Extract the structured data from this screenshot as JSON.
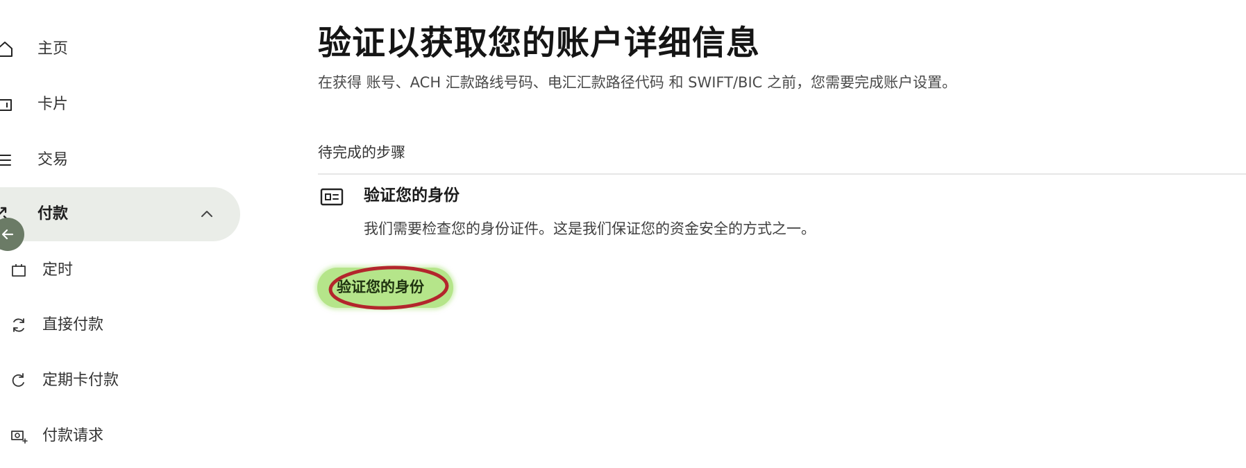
{
  "sidebar": {
    "items": [
      {
        "label": "主页",
        "icon": "home-icon"
      },
      {
        "label": "卡片",
        "icon": "card-icon"
      },
      {
        "label": "交易",
        "icon": "list-icon"
      },
      {
        "label": "付款",
        "icon": "payment-arrows-icon",
        "active": true,
        "expanded": true
      }
    ],
    "sub_items": [
      {
        "label": "定时",
        "icon": "calendar-icon"
      },
      {
        "label": "直接付款",
        "icon": "sync-icon"
      },
      {
        "label": "定期卡付款",
        "icon": "refresh-icon"
      },
      {
        "label": "付款请求",
        "icon": "request-icon"
      }
    ]
  },
  "main": {
    "title": "验证以获取您的账户详细信息",
    "subtitle": "在获得 账号、ACH 汇款路线号码、电汇汇款路径代码 和 SWIFT/BIC 之前，您需要完成账户设置。",
    "section_title": "待完成的步骤",
    "step": {
      "title": "验证您的身份",
      "description": "我们需要检查您的身份证件。这是我们保证您的资金安全的方式之一。",
      "button_label": "验证您的身份"
    }
  },
  "colors": {
    "accent": "#b5e58a",
    "active_nav_bg": "#eaede8",
    "collapse_button": "#6b7b66",
    "annotation_ring": "#b3262c"
  }
}
